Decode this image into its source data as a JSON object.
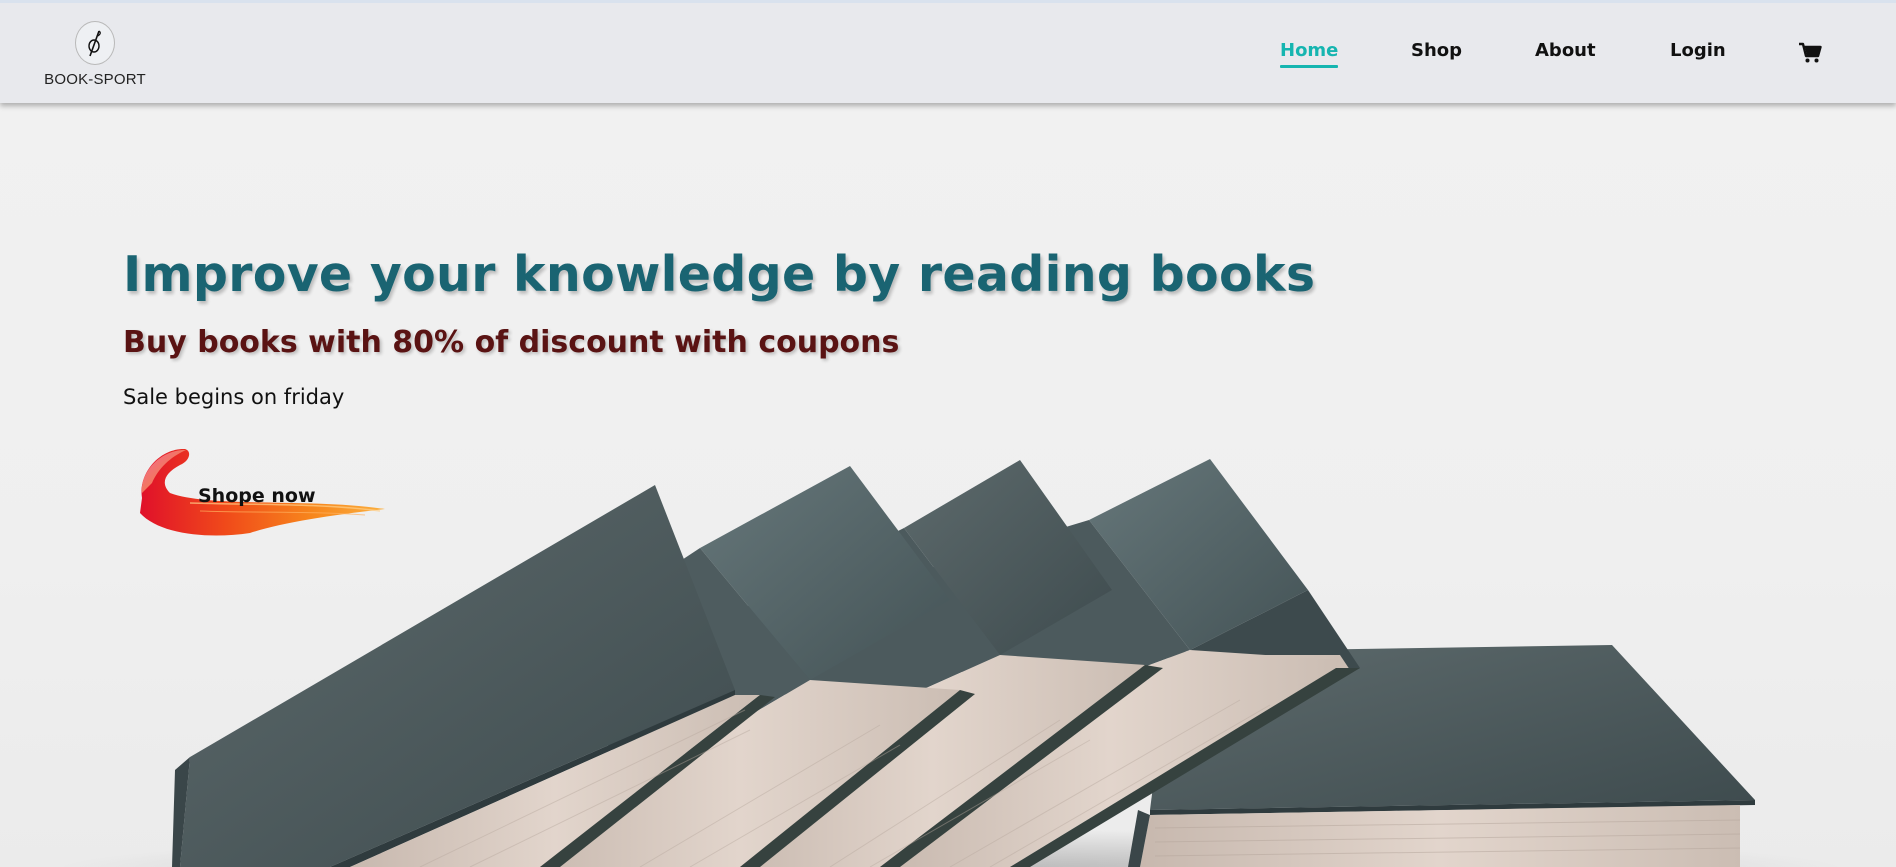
{
  "header": {
    "logo_text": "BOOK-SPORT",
    "nav": {
      "home": "Home",
      "shop": "Shop",
      "about": "About",
      "login": "Login"
    },
    "active_item": "Home",
    "cart_icon": "cart-icon"
  },
  "hero": {
    "title": "Improve your knowledge by reading books",
    "subtitle": "Buy books with 80% of discount with coupons",
    "sale_text": "Sale begins on friday",
    "cta_label": "Shope now"
  },
  "colors": {
    "accent": "#15b5b0",
    "title": "#1a6472",
    "subtitle": "#5a1313",
    "header_bg": "#e8e9ed"
  }
}
